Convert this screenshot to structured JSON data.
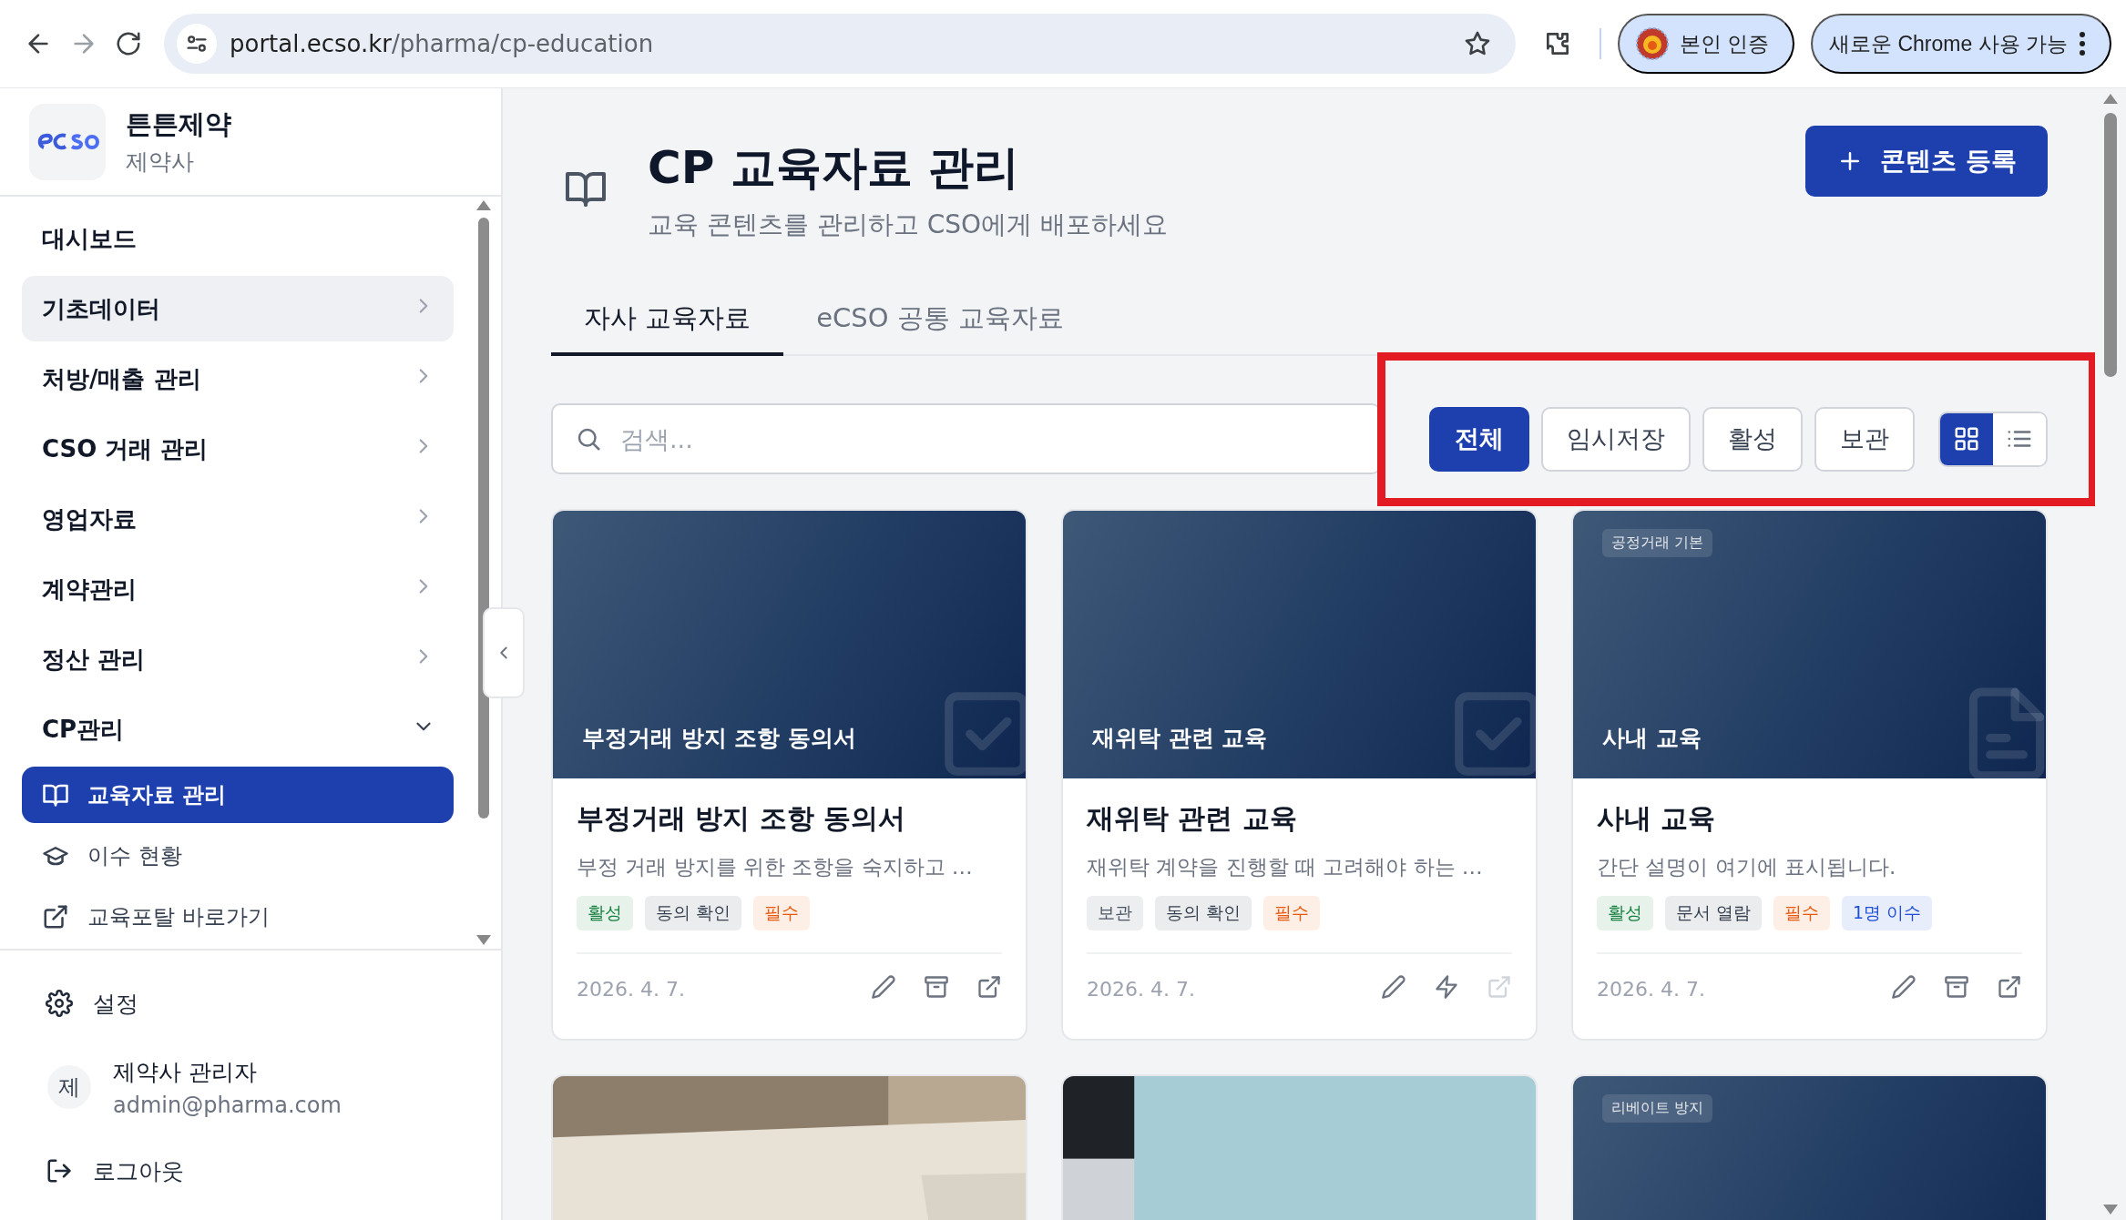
{
  "browser": {
    "url_host": "portal.ecso.kr",
    "url_path": "/pharma/cp-education",
    "profile_label": "본인 인증",
    "update_label": "새로운 Chrome 사용 가능"
  },
  "sidebar": {
    "company": "튼튼제약",
    "role": "제약사",
    "items": [
      {
        "label": "대시보드",
        "kind": "link",
        "hovered": false
      },
      {
        "label": "기초데이터",
        "kind": "group",
        "expanded": false,
        "hovered": true
      },
      {
        "label": "처방/매출 관리",
        "kind": "group",
        "expanded": false,
        "hovered": false
      },
      {
        "label": "CSO 거래 관리",
        "kind": "group",
        "expanded": false,
        "hovered": false
      },
      {
        "label": "영업자료",
        "kind": "group",
        "expanded": false,
        "hovered": false
      },
      {
        "label": "계약관리",
        "kind": "group",
        "expanded": false,
        "hovered": false
      },
      {
        "label": "정산 관리",
        "kind": "group",
        "expanded": false,
        "hovered": false
      },
      {
        "label": "CP관리",
        "kind": "group",
        "expanded": true,
        "hovered": false,
        "children": [
          {
            "label": "교육자료 관리",
            "selected": true
          },
          {
            "label": "이수 현황",
            "selected": false
          },
          {
            "label": "교육포탈 바로가기",
            "selected": false
          }
        ]
      }
    ],
    "settings": "설정",
    "user": {
      "initial": "제",
      "name": "제약사 관리자",
      "email": "admin@pharma.com"
    },
    "logout": "로그아웃"
  },
  "page": {
    "title": "CP 교육자료 관리",
    "subtitle": "교육 콘텐츠를 관리하고 CSO에게 배포하세요",
    "add_button": "콘텐츠 등록"
  },
  "tabs": [
    {
      "label": "자사 교육자료",
      "selected": true
    },
    {
      "label": "eCSO 공통 교육자료",
      "selected": false
    }
  ],
  "search": {
    "placeholder": "검색..."
  },
  "filters": {
    "highlighted": true,
    "options": [
      {
        "label": "전체",
        "selected": true
      },
      {
        "label": "임시저장",
        "selected": false
      },
      {
        "label": "활성",
        "selected": false
      },
      {
        "label": "보관",
        "selected": false
      }
    ],
    "views": [
      {
        "kind": "grid",
        "selected": true
      },
      {
        "kind": "list",
        "selected": false
      }
    ]
  },
  "cards": [
    {
      "kind": "agreement",
      "banner_title": "부정거래 방지 조항 동의서",
      "title": "부정거래 방지 조항 동의서",
      "description": "부정 거래 방지를 위한 조항을 숙지하고 …",
      "tags": [
        {
          "label": "활성",
          "color": "#15803d"
        },
        {
          "label": "동의 확인",
          "color": "#374151"
        },
        {
          "label": "필수",
          "color": "#ea580c"
        }
      ],
      "date": "2026. 4. 7.",
      "actions": [
        {
          "kind": "edit",
          "disabled": false
        },
        {
          "kind": "archive",
          "disabled": false
        },
        {
          "kind": "open",
          "disabled": false
        }
      ]
    },
    {
      "kind": "agreement",
      "banner_title": "재위탁 관련 교육",
      "title": "재위탁 관련 교육",
      "description": "재위탁 계약을 진행할 때 고려해야 하는 …",
      "tags": [
        {
          "label": "보관",
          "color": "#4b5563"
        },
        {
          "label": "동의 확인",
          "color": "#374151"
        },
        {
          "label": "필수",
          "color": "#ea580c"
        }
      ],
      "date": "2026. 4. 7.",
      "actions": [
        {
          "kind": "edit",
          "disabled": false
        },
        {
          "kind": "activate",
          "disabled": false
        },
        {
          "kind": "open",
          "disabled": true
        }
      ]
    },
    {
      "kind": "document",
      "category": "공정거래 기본",
      "banner_title": "사내 교육",
      "title": "사내 교육",
      "description": "간단 설명이 여기에 표시됩니다.",
      "tags": [
        {
          "label": "활성",
          "color": "#15803d"
        },
        {
          "label": "문서 열람",
          "color": "#374151"
        },
        {
          "label": "필수",
          "color": "#ea580c"
        },
        {
          "label": "1명 이수",
          "color": "#1d4ed8"
        }
      ],
      "date": "2026. 4. 7.",
      "actions": [
        {
          "kind": "edit",
          "disabled": false
        },
        {
          "kind": "archive",
          "disabled": false
        },
        {
          "kind": "open",
          "disabled": false
        }
      ]
    },
    {
      "kind": "picture"
    },
    {
      "kind": "picture"
    },
    {
      "kind": "plain",
      "category": "리베이트 방지"
    }
  ]
}
